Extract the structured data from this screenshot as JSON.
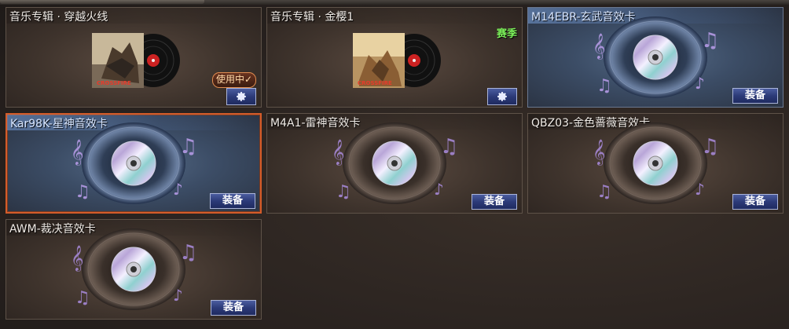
{
  "buttons": {
    "equip_label": "装备"
  },
  "status": {
    "in_use_label": "使用中✓",
    "season_label": "赛季"
  },
  "cards": [
    {
      "id": "album-crossfire",
      "title": "音乐专辑 · 穿越火线",
      "kind": "album",
      "art": "soldier-art",
      "state": "in-use"
    },
    {
      "id": "album-jinying",
      "title": "音乐专辑 · 金樱1",
      "kind": "album",
      "art": "desert-art",
      "state": "season"
    },
    {
      "id": "m14ebr",
      "title": "M14EBR-玄武音效卡",
      "kind": "sound-card",
      "theme": "blue",
      "state": "equip"
    },
    {
      "id": "kar98k",
      "title": "Kar98K-星神音效卡",
      "kind": "sound-card",
      "theme": "blue",
      "state": "equip",
      "selected": true
    },
    {
      "id": "m4a1",
      "title": "M4A1-雷神音效卡",
      "kind": "sound-card",
      "theme": "brown",
      "state": "equip"
    },
    {
      "id": "qbz03",
      "title": "QBZ03-金色蔷薇音效卡",
      "kind": "sound-card",
      "theme": "brown",
      "state": "equip"
    },
    {
      "id": "awm",
      "title": "AWM-裁决音效卡",
      "kind": "sound-card",
      "theme": "brown",
      "state": "equip"
    }
  ],
  "album_logo_text": "CROSSFIRE",
  "colors": {
    "selected_border": "#d45c2a",
    "button_blue": "#2c3a78",
    "season_green": "#7cf05a",
    "blue_card": "#3c4d66",
    "brown_card": "#3e332c"
  }
}
